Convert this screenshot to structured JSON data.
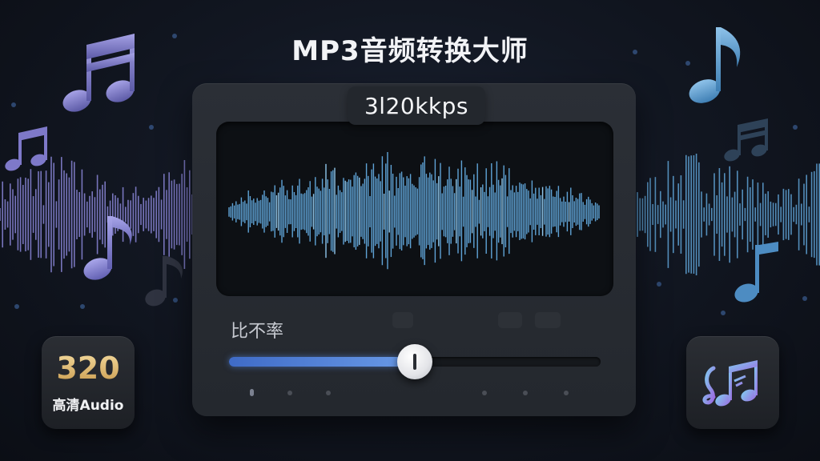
{
  "title": "MP3音频转换大师",
  "bitrate_display": "3l20kkps",
  "slider": {
    "label": "比不率",
    "value_fraction": 0.5
  },
  "badges": {
    "left_number": "320",
    "left_caption": "高清Audio",
    "right_icon": "music-notes-icon"
  },
  "colors": {
    "accent": "#5b8fe0",
    "waveform": "#5fa3d6",
    "left_wave": "#8a86d8",
    "note_purple": "#7f7fc4",
    "note_blue": "#5b9cd2",
    "badge_gold": "#e4c07a"
  }
}
